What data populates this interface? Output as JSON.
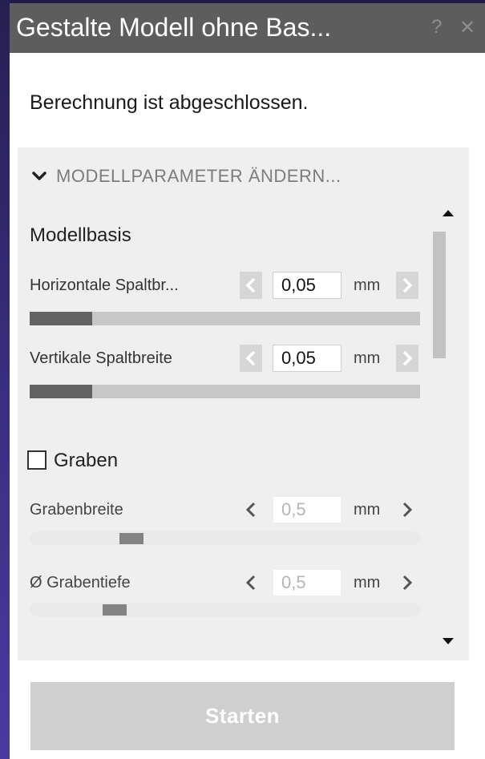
{
  "window": {
    "title": "Gestalte Modell ohne Bas...",
    "help_icon": "?",
    "close_icon": "✕"
  },
  "status_text": "Berechnung ist abgeschlossen.",
  "panel": {
    "header": "MODELLPARAMETER ÄNDERN...",
    "header_icon": "chevron-down-icon",
    "section_title": "Modellbasis",
    "horizontal_gap": {
      "label": "Horizontale Spaltbr...",
      "value": "0,05",
      "unit": "mm",
      "slider_fraction": 0.16
    },
    "vertical_gap": {
      "label": "Vertikale Spaltbreite",
      "value": "0,05",
      "unit": "mm",
      "slider_fraction": 0.16
    },
    "trench_checkbox": {
      "label": "Graben",
      "checked": false
    },
    "trench_width": {
      "label": "Grabenbreite",
      "value": "0,5",
      "unit": "mm"
    },
    "trench_depth": {
      "label": "Ø Grabentiefe",
      "value": "0,5",
      "unit": "mm"
    }
  },
  "start_button": "Starten",
  "colors": {
    "titlebar": "#5d5d5d",
    "panel_bg": "#efefef",
    "slider_fill": "#626262",
    "start_button_bg": "#cfcfcf"
  }
}
